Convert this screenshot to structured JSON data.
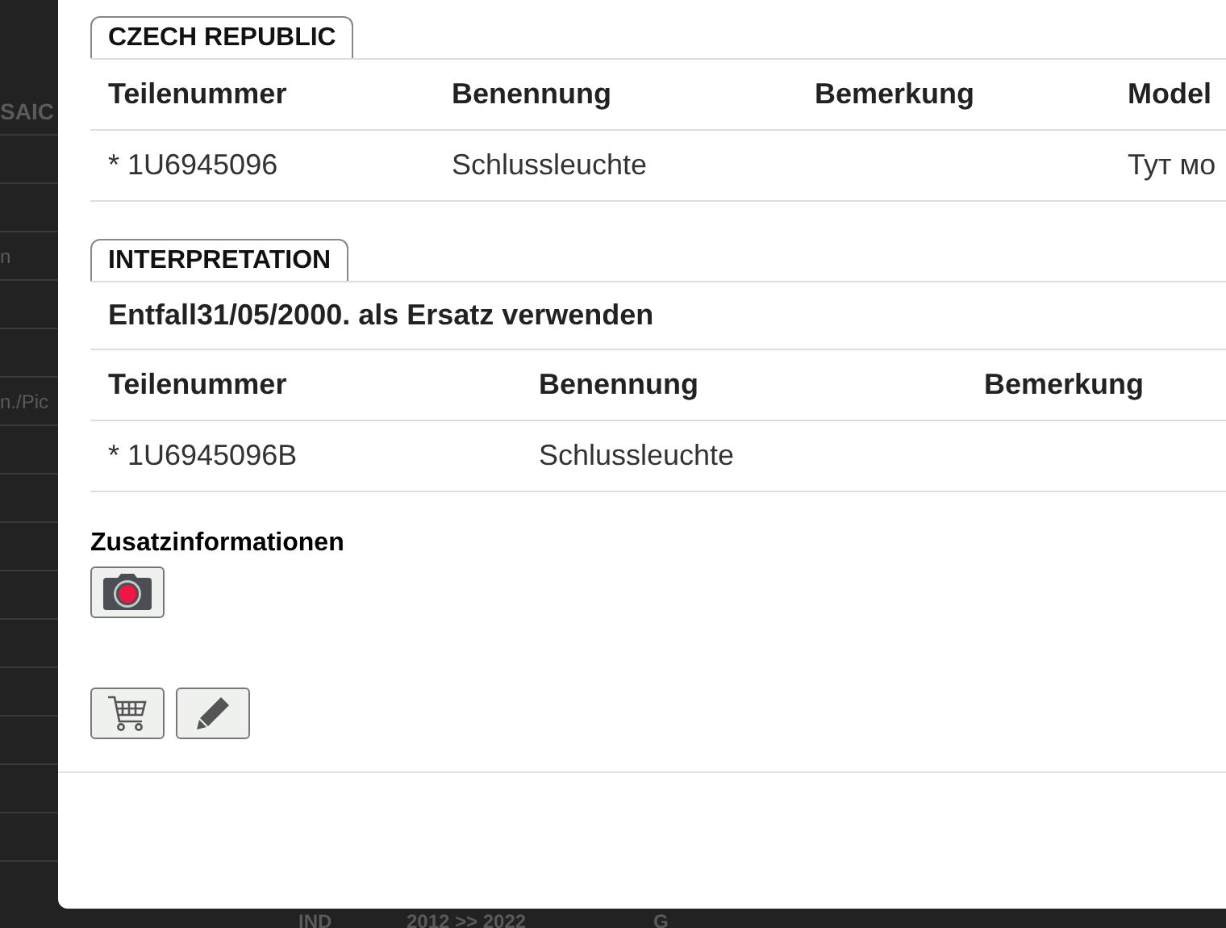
{
  "backdrop": {
    "rows": [
      {
        "label": "SAIC"
      },
      {},
      {},
      {
        "label": "n"
      },
      {},
      {},
      {
        "label": "n./Pic"
      },
      {},
      {},
      {},
      {},
      {},
      {},
      {},
      {},
      {}
    ],
    "bottom_row": [
      "IND",
      "2012 >> 2022",
      "G"
    ]
  },
  "dialog": {
    "sections": [
      {
        "tab": "CZECH REPUBLIC",
        "columns": [
          "Teilenummer",
          "Benennung",
          "Bemerkung",
          "Model"
        ],
        "rows": [
          {
            "cells": [
              "* 1U6945096",
              "Schlussleuchte",
              null,
              "Тут мо"
            ]
          }
        ]
      },
      {
        "tab": "INTERPRETATION",
        "note": "Entfall31/05/2000. als Ersatz verwenden",
        "columns": [
          "Teilenummer",
          "Benennung",
          "Bemerkung"
        ],
        "rows": [
          {
            "cells": [
              "* 1U6945096B",
              "Schlussleuchte",
              null
            ]
          }
        ]
      }
    ],
    "extra_info": {
      "title": "Zusatzinformationen",
      "buttons": [
        {
          "kind": "camera"
        }
      ]
    },
    "actions": [
      {
        "kind": "cart"
      },
      {
        "kind": "edit"
      }
    ]
  }
}
